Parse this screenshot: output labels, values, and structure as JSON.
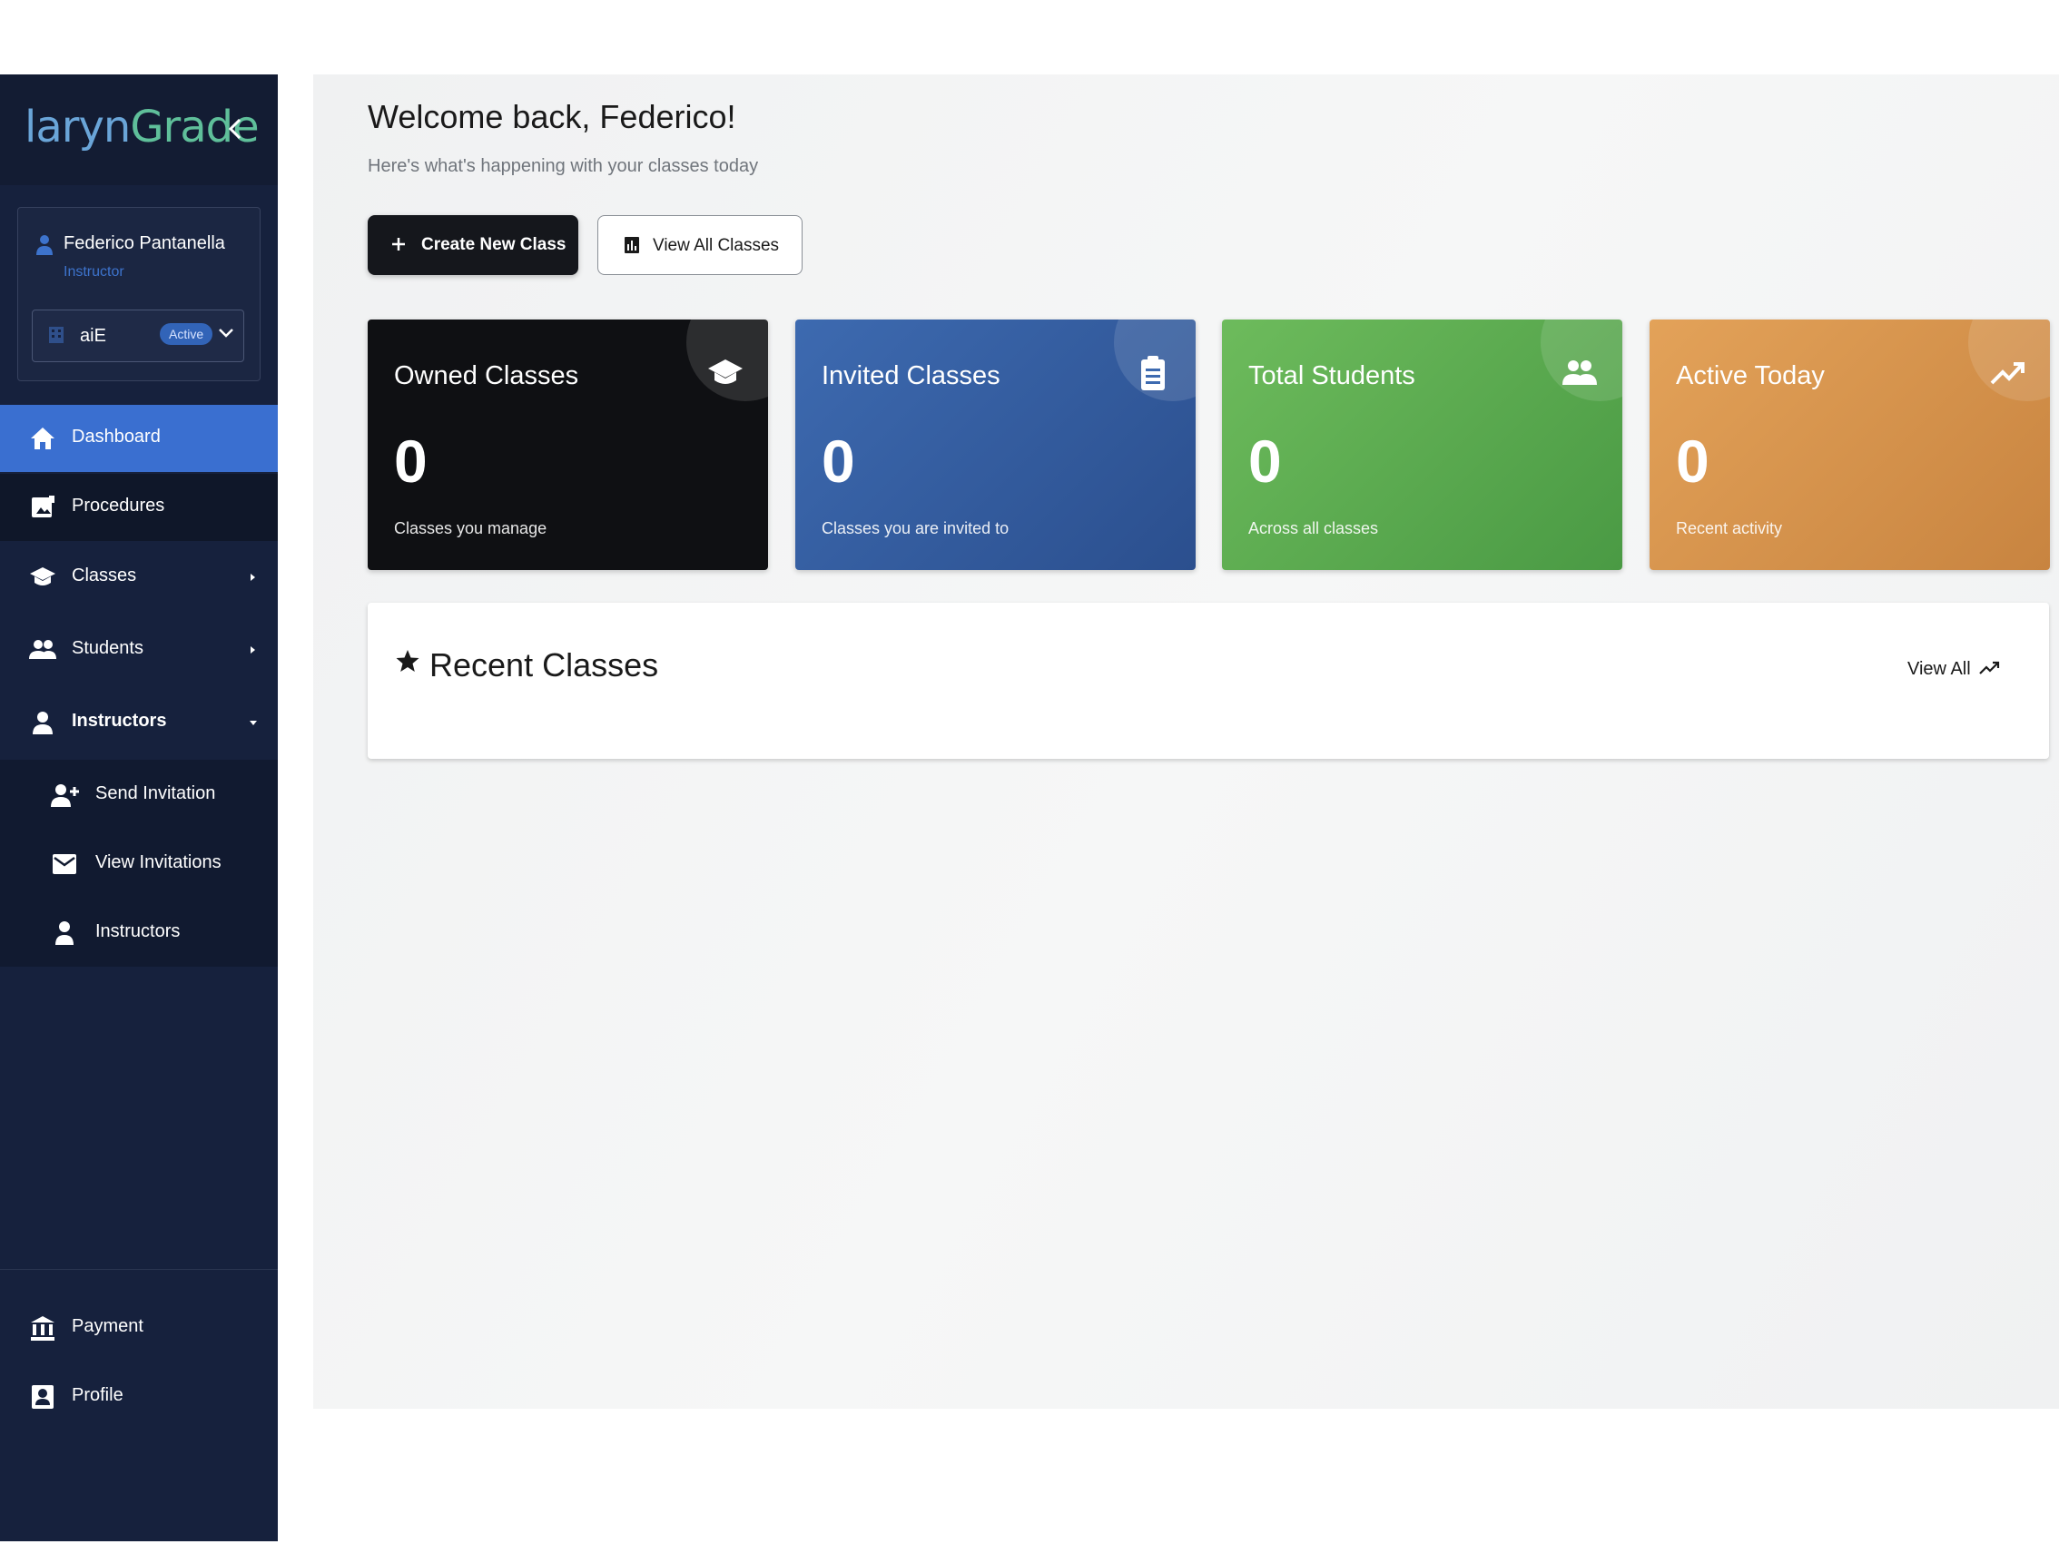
{
  "brand": {
    "prefix": "laryn",
    "suffix": "Grade"
  },
  "user": {
    "name": "Federico Pantanella",
    "role": "Instructor"
  },
  "org": {
    "name": "aiE",
    "badge": "Active"
  },
  "nav": {
    "dashboard": "Dashboard",
    "procedures": "Procedures",
    "classes": "Classes",
    "students": "Students",
    "instructors": "Instructors",
    "send_invitation": "Send Invitation",
    "view_invitations": "View Invitations",
    "instructors_sub": "Instructors",
    "payment": "Payment",
    "profile": "Profile"
  },
  "main": {
    "title": "Welcome back, Federico!",
    "subtitle": "Here's what's happening with your classes today",
    "create_button": "Create New Class",
    "view_all_classes_button": "View All Classes"
  },
  "stats": [
    {
      "title": "Owned Classes",
      "value": "0",
      "desc": "Classes you manage",
      "icon": "graduation-cap-icon",
      "color": "#0f1013"
    },
    {
      "title": "Invited Classes",
      "value": "0",
      "desc": "Classes you are invited to",
      "icon": "clipboard-icon",
      "color": "#3d6ab0"
    },
    {
      "title": "Total Students",
      "value": "0",
      "desc": "Across all classes",
      "icon": "people-icon",
      "color": "#6dbb5c"
    },
    {
      "title": "Active Today",
      "value": "0",
      "desc": "Recent activity",
      "icon": "trending-up-icon",
      "color": "#e3a259"
    }
  ],
  "recent": {
    "title": "Recent Classes",
    "view_all": "View All"
  },
  "colors": {
    "sidebar": "#16213d",
    "active_nav": "#3a6fd0",
    "accent": "#3264b8"
  }
}
